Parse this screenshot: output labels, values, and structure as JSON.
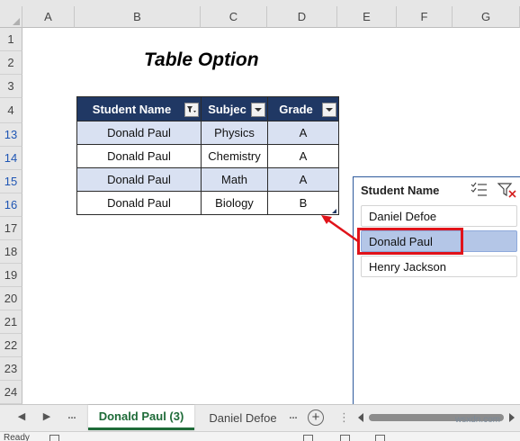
{
  "columns": [
    "A",
    "B",
    "C",
    "D",
    "E",
    "F",
    "G"
  ],
  "rows": [
    "1",
    "2",
    "3",
    "4",
    "13",
    "14",
    "15",
    "16",
    "17",
    "18",
    "19",
    "20",
    "21",
    "22",
    "23",
    "24"
  ],
  "title": "Table Option",
  "table": {
    "headers": [
      "Student Name",
      "Subject",
      "Grade"
    ],
    "header_display": [
      "Student Name",
      "Subjec",
      "Grade"
    ],
    "rows": [
      [
        "Donald Paul",
        "Physics",
        "A"
      ],
      [
        "Donald Paul",
        "Chemistry",
        "A"
      ],
      [
        "Donald Paul",
        "Math",
        "A"
      ],
      [
        "Donald Paul",
        "Biology",
        "B"
      ]
    ]
  },
  "slicer": {
    "title": "Student Name",
    "items": [
      {
        "label": "Daniel Defoe",
        "selected": false
      },
      {
        "label": "Donald Paul",
        "selected": true
      },
      {
        "label": "Henry Jackson",
        "selected": false
      }
    ]
  },
  "sheet_tabs": [
    {
      "label": "Donald Paul (3)",
      "active": true
    },
    {
      "label": "Daniel Defoe",
      "active": false
    }
  ],
  "tab_overflow": "...",
  "status": "Ready",
  "watermark": "wsxdn.com",
  "colors": {
    "table_header": "#203864",
    "band": "#d9e1f2",
    "slicer_selected": "#b4c6e7",
    "highlight": "#e0131a",
    "active_tab": "#1e6b38"
  }
}
